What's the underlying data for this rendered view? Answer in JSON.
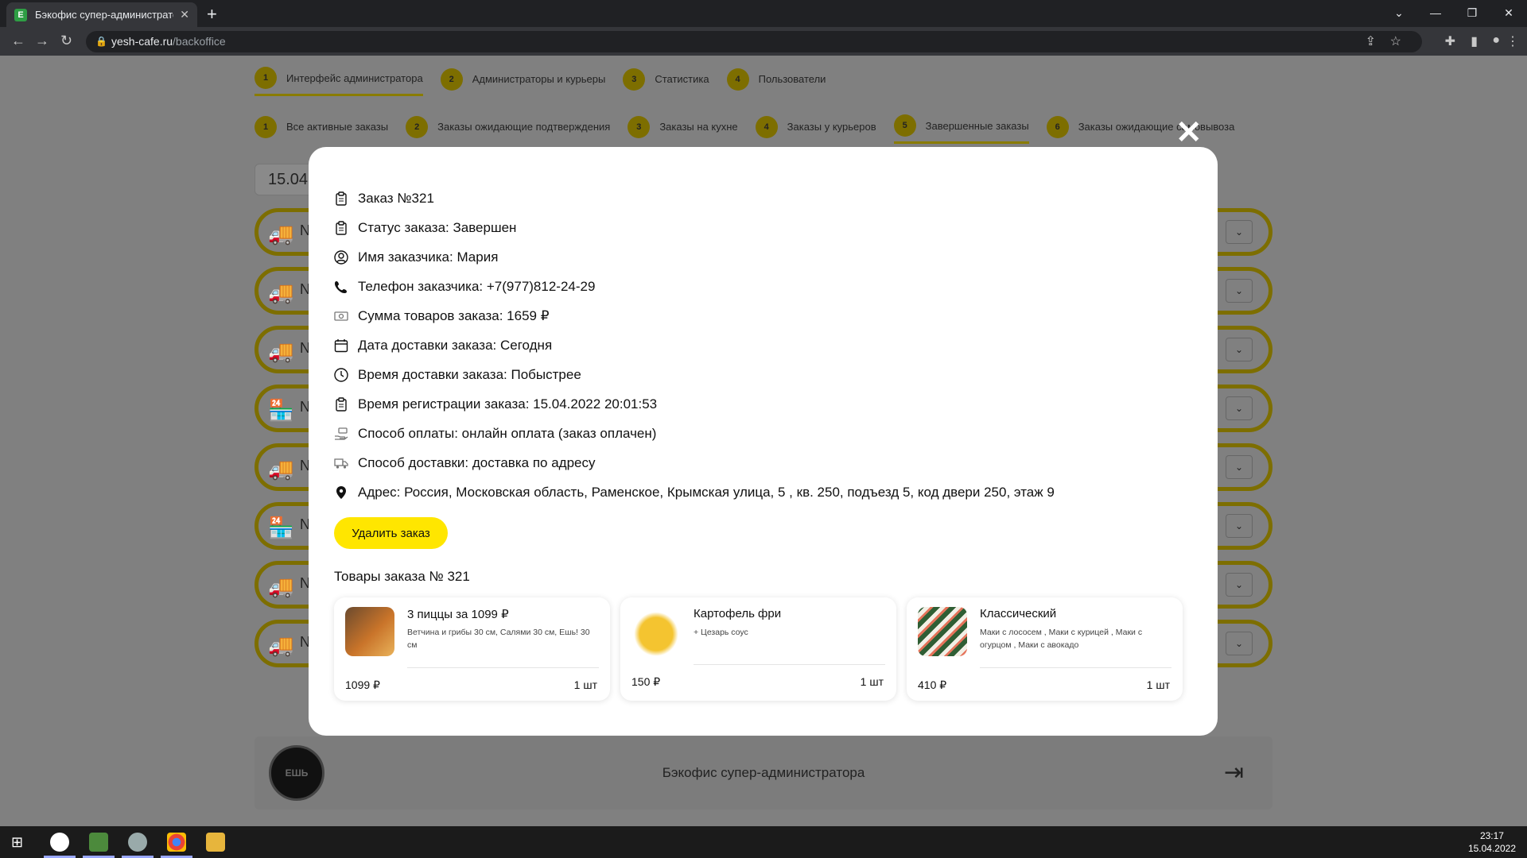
{
  "browser": {
    "tab_title": "Бэкофис супер-администраторa",
    "url_host": "yesh-cafe.ru",
    "url_path": "/backoffice"
  },
  "top_nav": [
    {
      "num": "1",
      "label": "Интерфейс администратора"
    },
    {
      "num": "2",
      "label": "Администраторы и курьеры"
    },
    {
      "num": "3",
      "label": "Статистика"
    },
    {
      "num": "4",
      "label": "Пользователи"
    }
  ],
  "sub_nav": [
    {
      "num": "1",
      "label": "Все активные заказы"
    },
    {
      "num": "2",
      "label": "Заказы ожидающие подтверждения"
    },
    {
      "num": "3",
      "label": "Заказы на кухне"
    },
    {
      "num": "4",
      "label": "Заказы у курьеров"
    },
    {
      "num": "5",
      "label": "Завершенные заказы"
    },
    {
      "num": "6",
      "label": "Заказы ожидающие самовывоза"
    }
  ],
  "date_filter": "15.04",
  "order_row_prefix": "N",
  "modal": {
    "order_number": "Заказ №321",
    "status": "Статус заказа: Завершен",
    "customer_name": "Имя заказчика: Мария",
    "phone": "Телефон заказчика: +7(977)812-24-29",
    "total": "Сумма товаров заказа: 1659 ₽",
    "delivery_date": "Дата доставки заказа: Сегодня",
    "delivery_time": "Время доставки заказа: Побыстрее",
    "registered": "Время регистрации заказа: 15.04.2022 20:01:53",
    "payment": "Способ оплаты: онлайн оплата (заказ оплачен)",
    "delivery_method": "Способ доставки: доставка по адресу",
    "address": "Адрес: Россия, Московская область, Раменское, Крымская улица, 5 , кв. 250, подъезд 5, код двери 250, этаж 9",
    "delete_label": "Удалить заказ",
    "goods_title": "Товары заказа № 321",
    "goods": [
      {
        "name": "3 пиццы за 1099 ₽",
        "desc": "Ветчина и грибы 30 см, Салями 30 см, Ешь! 30 см",
        "price": "1099 ₽",
        "qty": "1 шт"
      },
      {
        "name": "Картофель фри",
        "desc": "+ Цезарь соус",
        "price": "150 ₽",
        "qty": "1 шт"
      },
      {
        "name": "Классический",
        "desc": "Маки с лососем , Маки с курицей , Маки с огурцом , Маки с авокадо",
        "price": "410 ₽",
        "qty": "1 шт"
      }
    ]
  },
  "footer_title": "Бэкофис супер-администратора",
  "clock": {
    "time": "23:17",
    "date": "15.04.2022"
  },
  "colors": {
    "accent": "#ffe600",
    "dim_overlay": "#808080"
  }
}
